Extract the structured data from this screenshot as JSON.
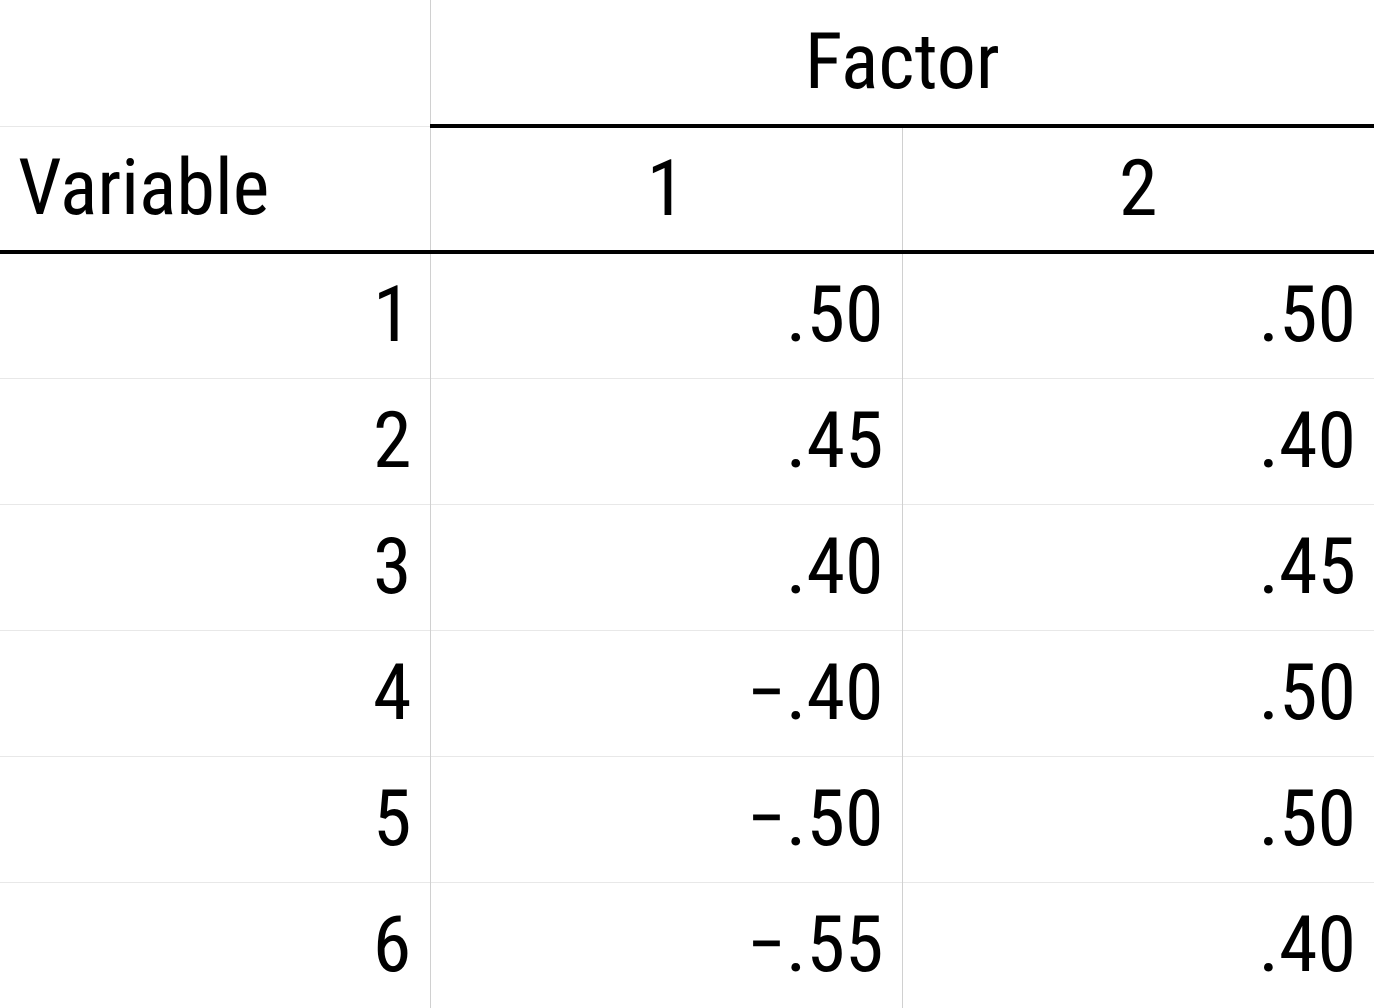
{
  "chart_data": {
    "type": "table",
    "title": "",
    "spanner_label": "Factor",
    "row_header_label": "Variable",
    "column_headers": [
      "1",
      "2"
    ],
    "rows": [
      {
        "variable": "1",
        "factor1": ".50",
        "factor2": ".50"
      },
      {
        "variable": "2",
        "factor1": ".45",
        "factor2": ".40"
      },
      {
        "variable": "3",
        "factor1": ".40",
        "factor2": ".45"
      },
      {
        "variable": "4",
        "factor1": "−.40",
        "factor2": ".50"
      },
      {
        "variable": "5",
        "factor1": "−.50",
        "factor2": ".50"
      },
      {
        "variable": "6",
        "factor1": "−.55",
        "factor2": ".40"
      }
    ]
  }
}
